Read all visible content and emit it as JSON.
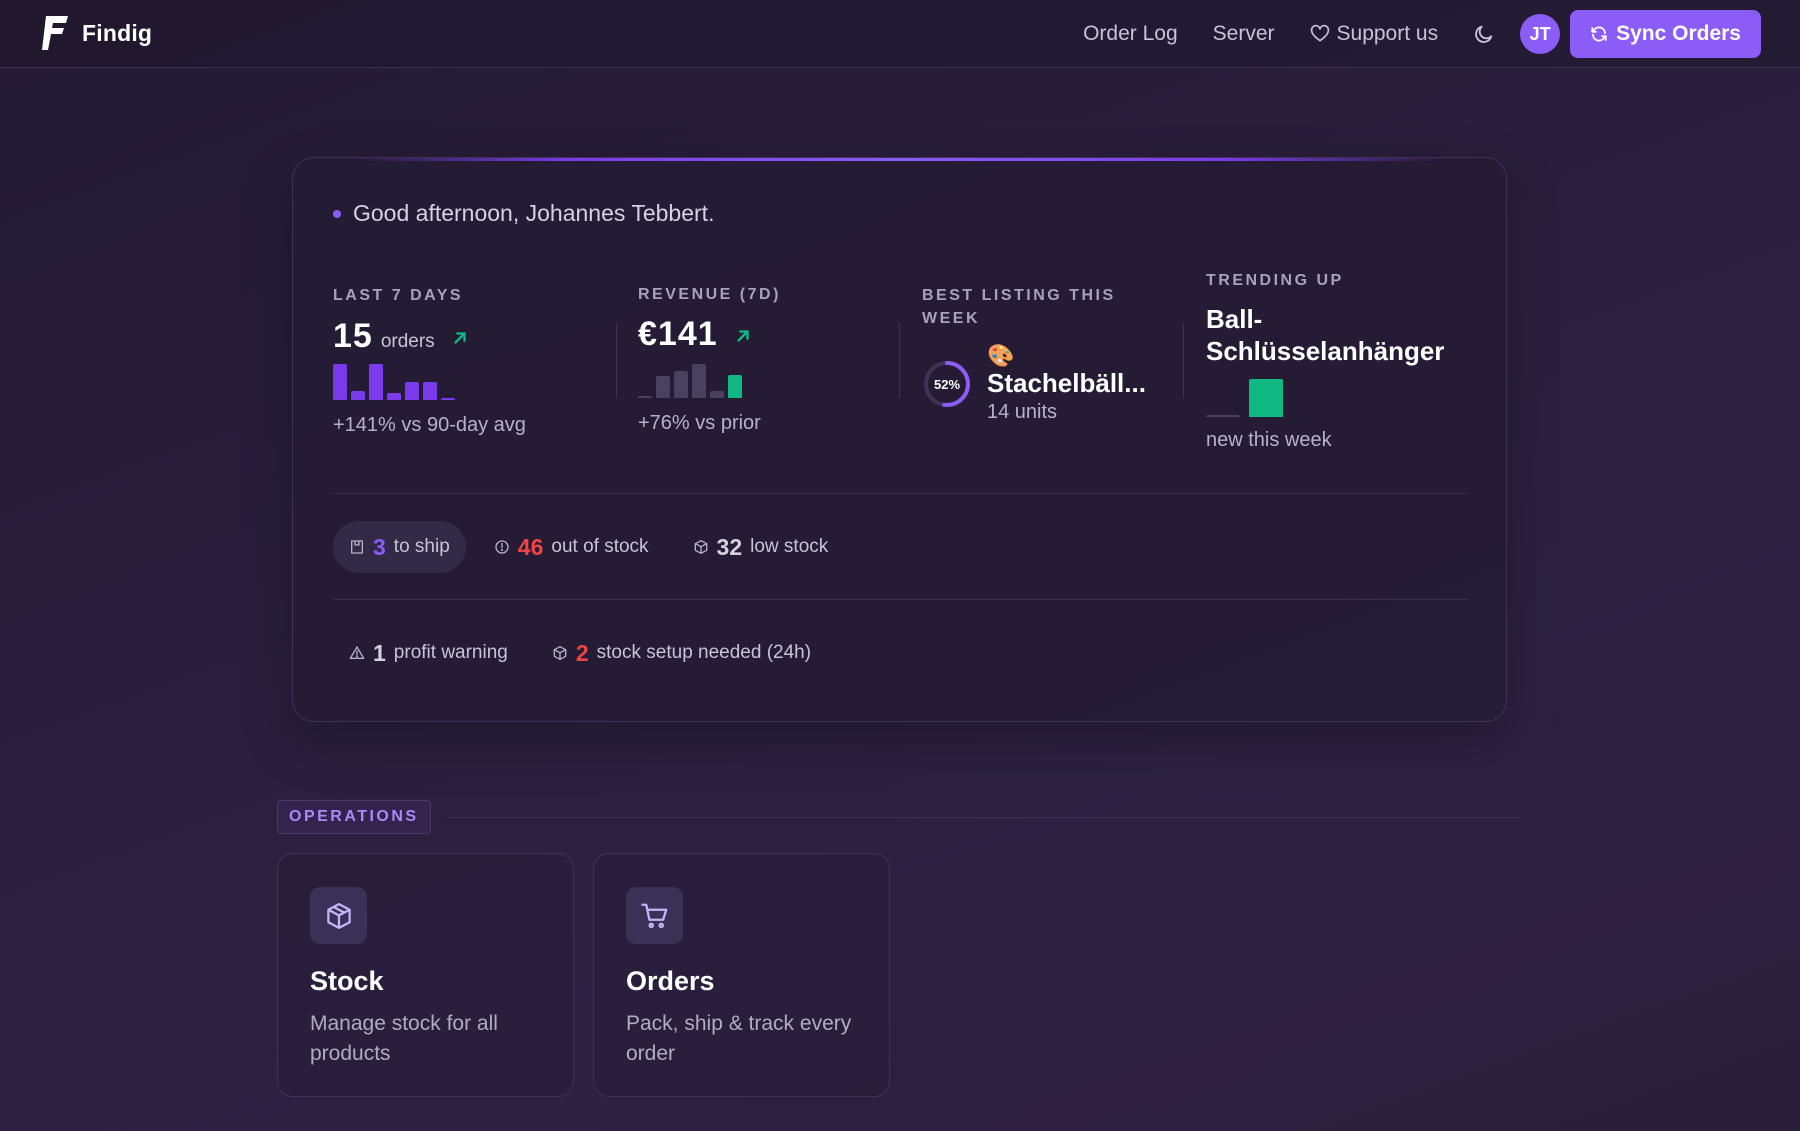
{
  "brand": {
    "name": "Findig"
  },
  "nav": {
    "order_log": "Order Log",
    "server": "Server",
    "support": "Support us",
    "avatar_initials": "JT",
    "sync_label": "Sync Orders"
  },
  "summary": {
    "greeting": "Good afternoon, Johannes Tebbert.",
    "orders": {
      "label": "LAST 7 DAYS",
      "value": "15",
      "unit": "orders",
      "sub": "+141% vs 90-day avg",
      "spark": [
        1.0,
        0.25,
        1.0,
        0.2,
        0.5,
        0.5,
        0.05
      ]
    },
    "revenue": {
      "label": "REVENUE (7D)",
      "value": "€141",
      "sub": "+76% vs prior",
      "spark": [
        0.05,
        0.6,
        0.75,
        0.95,
        0.2,
        0.65
      ]
    },
    "best": {
      "label": "BEST LISTING THIS WEEK",
      "percent": 52,
      "percent_label": "52%",
      "emoji": "🎨",
      "title": "Stachelbäll...",
      "units": "14 units"
    },
    "trending": {
      "label": "TRENDING UP",
      "title": "Ball-Schlüsselanhänger",
      "sub": "new this week",
      "spark": [
        0.05,
        1.0
      ]
    },
    "stock_chips": [
      {
        "num": "3",
        "text": "to ship",
        "icon": "package-icon",
        "color": "#8b5cf6"
      },
      {
        "num": "46",
        "text": "out of stock",
        "icon": "alert-circle-icon",
        "color": "#ef4444"
      },
      {
        "num": "32",
        "text": "low stock",
        "icon": "box-icon",
        "color": "#d6d0e2"
      }
    ],
    "warning_chips": [
      {
        "num": "1",
        "text": "profit warning",
        "icon": "warning-triangle-icon",
        "color": "#d6d0e2"
      },
      {
        "num": "2",
        "text": "stock setup needed (24h)",
        "icon": "box-icon",
        "color": "#ef4444"
      }
    ]
  },
  "operations": {
    "tag": "OPERATIONS",
    "cards": [
      {
        "title": "Stock",
        "desc": "Manage stock for all products",
        "icon": "cube-icon"
      },
      {
        "title": "Orders",
        "desc": "Pack, ship & track every order",
        "icon": "cart-icon"
      }
    ]
  },
  "colors": {
    "accent": "#8b5cf6",
    "success": "#10b981",
    "danger": "#ef4444",
    "background": "#2a1f3d"
  }
}
